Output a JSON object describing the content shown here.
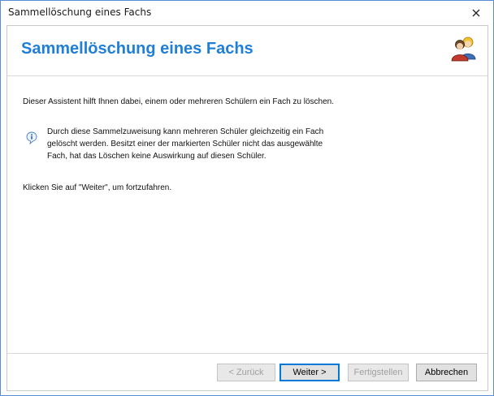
{
  "window": {
    "title": "Sammellöschung eines Fachs"
  },
  "header": {
    "title": "Sammellöschung eines Fachs",
    "icon": "users-icon"
  },
  "content": {
    "intro": "Dieser Assistent hilft Ihnen dabei, einem oder mehreren Schülern ein Fach zu löschen.",
    "info_lines": [
      "Durch diese Sammelzuweisung kann mehreren Schüler gleichzeitig ein Fach",
      "gelöscht werden. Besitzt einer der markierten Schüler nicht das ausgewählte",
      "Fach, hat das Löschen keine Auswirkung auf diesen Schüler."
    ],
    "hint": "Klicken Sie auf \"Weiter\", um fortzufahren."
  },
  "buttons": {
    "back": "< Zurück",
    "next": "Weiter >",
    "finish": "Fertigstellen",
    "cancel": "Abbrechen"
  },
  "colors": {
    "header_title": "#1f7fd8",
    "window_border": "#5a8bd6",
    "default_button_border": "#0078d7"
  }
}
